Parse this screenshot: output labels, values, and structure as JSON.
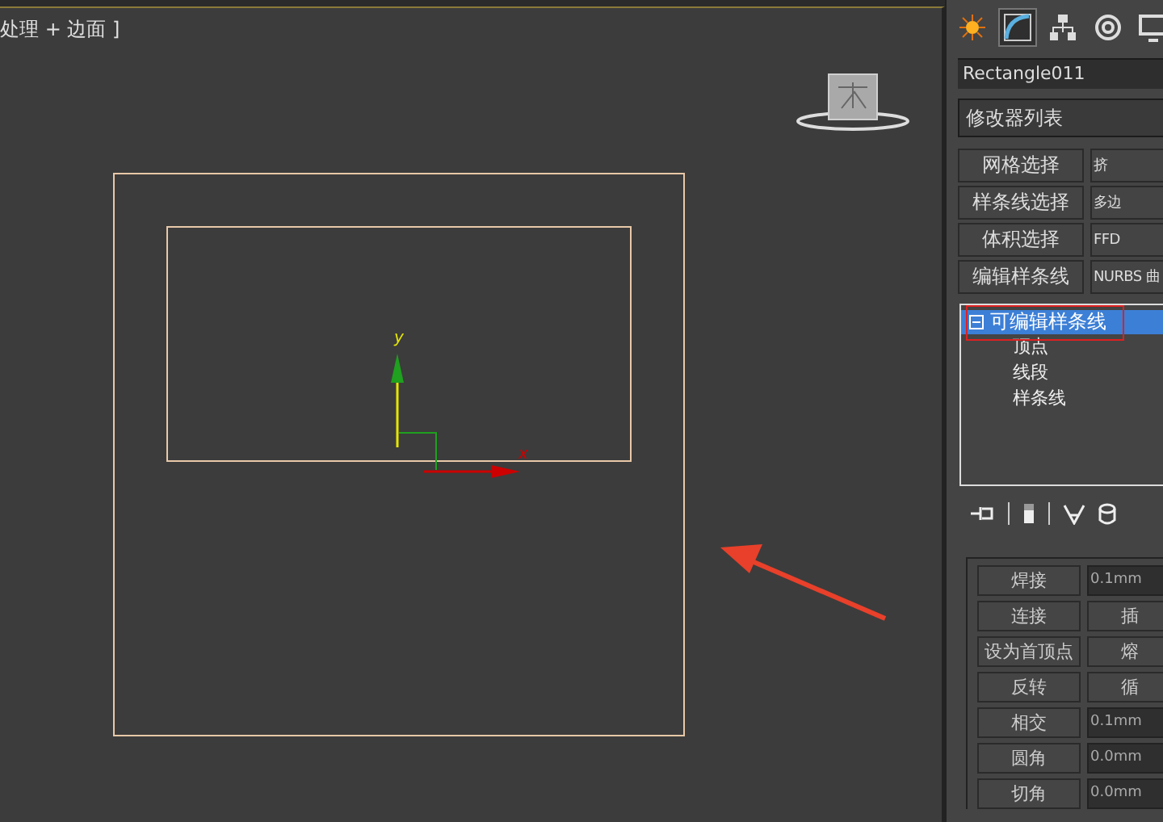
{
  "viewport": {
    "label": "处理 + 边面 ]",
    "axis_labels": {
      "y": "y",
      "x": "x"
    }
  },
  "panel": {
    "tabs": [
      {
        "kind": "sun",
        "selected": false
      },
      {
        "kind": "curve",
        "selected": true
      },
      {
        "kind": "hierarchy",
        "selected": false
      },
      {
        "kind": "motion",
        "selected": false
      },
      {
        "kind": "display",
        "selected": false
      }
    ],
    "object_name": "Rectangle011",
    "modifier_list": "修改器列表",
    "modifier_buttons": [
      "网格选择",
      "挤",
      "样条线选择",
      "多边",
      "体积选择",
      "FFD",
      "编辑样条线",
      "NURBS 曲"
    ],
    "stack": [
      {
        "label": "可编辑样条线",
        "selected": true,
        "expanded": true,
        "children": [
          {
            "label": "顶点",
            "selected": false
          },
          {
            "label": "线段",
            "selected": false
          },
          {
            "label": "样条线",
            "selected": false
          }
        ]
      }
    ],
    "rollout": [
      {
        "kind": "field",
        "button": "焊接",
        "value": "0.1mm"
      },
      {
        "kind": "pair",
        "button": "连接",
        "second": "插"
      },
      {
        "kind": "pair",
        "button": "设为首顶点",
        "second": "熔"
      },
      {
        "kind": "pair",
        "button": "反转",
        "second": "循"
      },
      {
        "kind": "field",
        "button": "相交",
        "value": "0.1mm"
      },
      {
        "kind": "field",
        "button": "圆角",
        "value": "0.0mm"
      },
      {
        "kind": "field",
        "button": "切角",
        "value": "0.0mm"
      }
    ]
  }
}
